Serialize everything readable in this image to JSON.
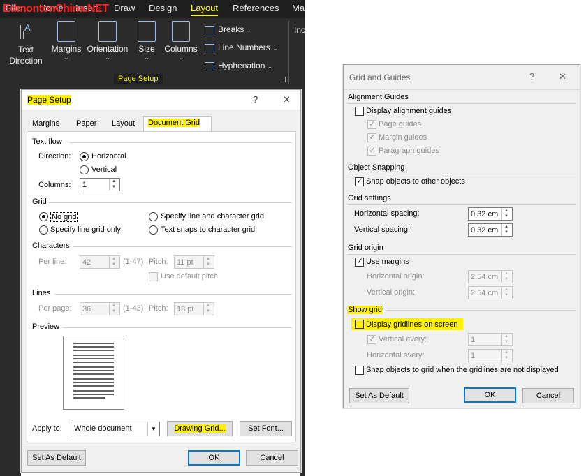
{
  "ribbon": {
    "watermark": "EdmontonChina.NET",
    "tabs": [
      "File",
      "Home",
      "Insert",
      "Draw",
      "Design",
      "Layout",
      "References",
      "Ma"
    ],
    "active_tab": "Layout",
    "buttons": {
      "text_direction": "Text Direction",
      "margins": "Margins",
      "orientation": "Orientation",
      "size": "Size",
      "columns": "Columns"
    },
    "small_buttons": {
      "breaks": "Breaks",
      "line_numbers": "Line Numbers",
      "hyphenation": "Hyphenation"
    },
    "group_label": "Page Setup",
    "right_stub": "Inc",
    "dropdown_arrow": "⌄"
  },
  "page_setup": {
    "title": "Page Setup",
    "help": "?",
    "close": "✕",
    "tabs": [
      "Margins",
      "Paper",
      "Layout",
      "Document Grid"
    ],
    "text_flow": {
      "label": "Text flow",
      "direction_label": "Direction:",
      "horizontal": "Horizontal",
      "vertical": "Vertical",
      "columns_label": "Columns:",
      "columns_value": "1"
    },
    "grid": {
      "label": "Grid",
      "no_grid": "No grid",
      "line_grid_only": "Specify line grid only",
      "line_and_char": "Specify line and character grid",
      "text_snaps": "Text snaps to character grid"
    },
    "characters": {
      "label": "Characters",
      "per_line_label": "Per line:",
      "per_line_value": "42",
      "per_line_range": "(1-47)",
      "pitch_label": "Pitch:",
      "pitch_value": "11 pt",
      "use_default_pitch": "Use default pitch"
    },
    "lines": {
      "label": "Lines",
      "per_page_label": "Per page:",
      "per_page_value": "36",
      "per_page_range": "(1-43)",
      "pitch_label": "Pitch:",
      "pitch_value": "18 pt"
    },
    "preview_label": "Preview",
    "apply_to_label": "Apply to:",
    "apply_to_value": "Whole document",
    "drawing_grid": "Drawing Grid...",
    "set_font": "Set Font...",
    "set_as_default": "Set As Default",
    "ok": "OK",
    "cancel": "Cancel"
  },
  "grid_guides": {
    "title": "Grid and Guides",
    "help": "?",
    "close": "✕",
    "alignment_guides": {
      "label": "Alignment Guides",
      "display": "Display alignment guides",
      "page_guides": "Page guides",
      "margin_guides": "Margin guides",
      "paragraph_guides": "Paragraph guides"
    },
    "object_snapping": {
      "label": "Object Snapping",
      "snap_objects": "Snap objects to other objects"
    },
    "grid_settings": {
      "label": "Grid settings",
      "horizontal_label": "Horizontal spacing:",
      "horizontal_value": "0.32 cm",
      "vertical_label": "Vertical spacing:",
      "vertical_value": "0.32 cm"
    },
    "grid_origin": {
      "label": "Grid origin",
      "use_margins": "Use margins",
      "horizontal_label": "Horizontal origin:",
      "horizontal_value": "2.54 cm",
      "vertical_label": "Vertical origin:",
      "vertical_value": "2.54 cm"
    },
    "show_grid": {
      "label": "Show grid",
      "display_gridlines": "Display gridlines on screen",
      "vertical_every": "Vertical every:",
      "vertical_value": "1",
      "horizontal_every": "Horizontal every:",
      "horizontal_value": "1",
      "snap_when_hidden": "Snap objects to grid when the gridlines are not displayed"
    },
    "set_as_default": "Set As Default",
    "ok": "OK",
    "cancel": "Cancel"
  },
  "colors": {
    "highlight": "#fff200",
    "ribbon_bg": "#2b2b2b",
    "accent": "#0078d7"
  }
}
